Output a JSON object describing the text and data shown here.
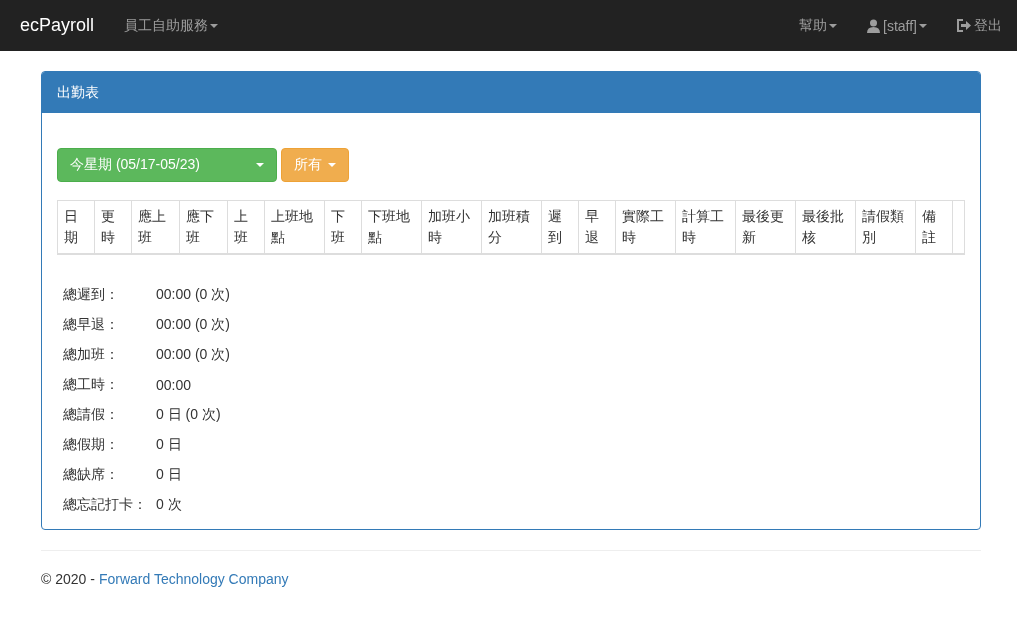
{
  "navbar": {
    "brand": "ecPayroll",
    "menu": "員工自助服務",
    "help": "幫助",
    "user": "[staff]",
    "logout": "登出"
  },
  "panel": {
    "title": "出勤表",
    "period": "今星期 (05/17-05/23)",
    "filter": "所有",
    "columns": [
      "日期",
      "更時",
      "應上班",
      "應下班",
      "上班",
      "上班地點",
      "下班",
      "下班地點",
      "加班小時",
      "加班積分",
      "遲到",
      "早退",
      "實際工時",
      "計算工時",
      "最後更新",
      "最後批核",
      "請假類別",
      "備註"
    ],
    "summary": [
      {
        "label": "總遲到：",
        "value": "00:00 (0 次)"
      },
      {
        "label": "總早退：",
        "value": "00:00 (0 次)"
      },
      {
        "label": "總加班：",
        "value": "00:00 (0 次)"
      },
      {
        "label": "總工時：",
        "value": "00:00"
      },
      {
        "label": "總請假：",
        "value": "0 日 (0 次)"
      },
      {
        "label": "總假期：",
        "value": "0 日"
      },
      {
        "label": "總缺席：",
        "value": "0 日"
      },
      {
        "label": "總忘記打卡：",
        "value": "0 次"
      }
    ]
  },
  "footer": {
    "copyright": "© 2020 -",
    "company": "Forward Technology Company"
  }
}
